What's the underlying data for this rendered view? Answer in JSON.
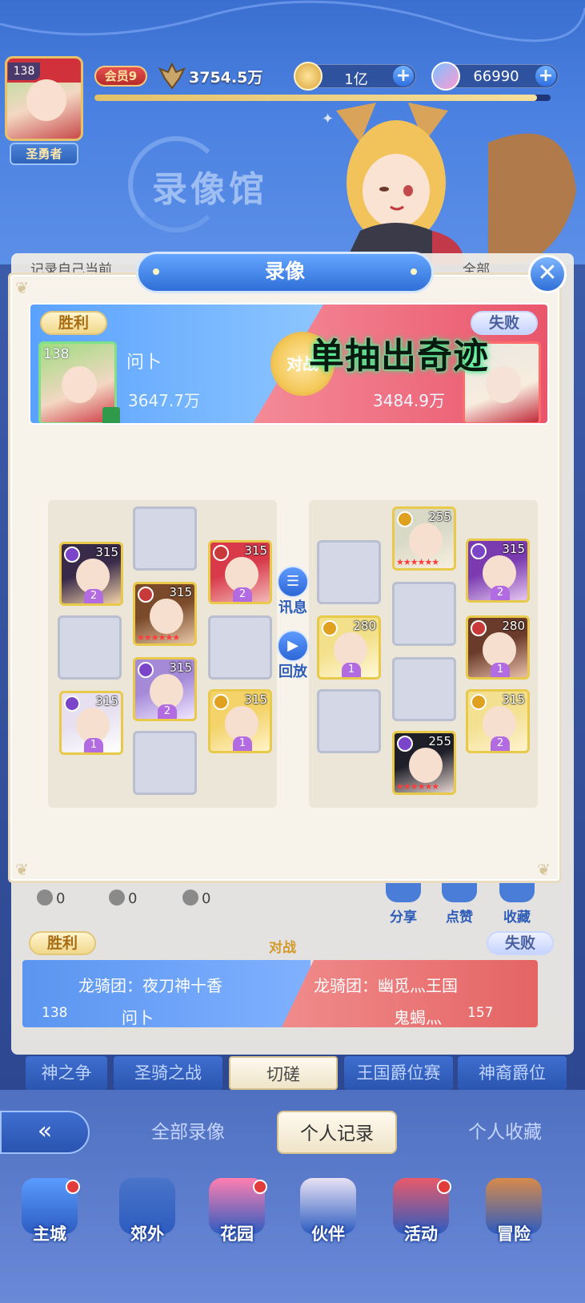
{
  "header": {
    "player_level": "138",
    "player_title": "圣勇者",
    "vip": "会员9",
    "power": "3754.5万",
    "power_bar_pct": 0.97,
    "gold": "1亿",
    "gems": "66990",
    "hall_title": "录像馆"
  },
  "list": {
    "hint": "记录自己当前",
    "all": "全部"
  },
  "modal": {
    "title": "录像",
    "close": "✕",
    "left": {
      "result": "胜利",
      "level": "138",
      "name": "问卜",
      "power": "3647.7万"
    },
    "right": {
      "result": "失败",
      "power": "3484.9万"
    },
    "vs_label": "对战",
    "overlay_caption": "单抽出奇迹",
    "mid_buttons": [
      {
        "label": "讯息",
        "icon": "message-icon"
      },
      {
        "label": "回放",
        "icon": "replay-icon"
      }
    ],
    "left_team": [
      {
        "slot": "empty"
      },
      {
        "slot": "hero",
        "level": "315",
        "star": "2",
        "colors": [
          "#3a2a4a",
          "#f2d2a8"
        ],
        "type_color": "#7a45c8"
      },
      {
        "slot": "hero",
        "level": "315",
        "star": "2",
        "colors": [
          "#d83a4a",
          "#f3b8b8"
        ],
        "type_color": "#c83a3a"
      },
      {
        "slot": "hero",
        "level": "315",
        "star": "",
        "colors": [
          "#7a4a2a",
          "#e8c8a8"
        ],
        "type_color": "#c83a3a"
      },
      {
        "slot": "empty"
      },
      {
        "slot": "empty"
      },
      {
        "slot": "hero",
        "level": "315",
        "star": "2",
        "colors": [
          "#a58ad8",
          "#efe6ff"
        ],
        "type_color": "#7a45c8"
      },
      {
        "slot": "hero",
        "level": "315",
        "star": "1",
        "colors": [
          "#e6e0f0",
          "#ffffff"
        ],
        "type_color": "#7a45c8"
      },
      {
        "slot": "hero",
        "level": "315",
        "star": "1",
        "colors": [
          "#f3d36a",
          "#fff2c8"
        ],
        "type_color": "#e0a020"
      },
      {
        "slot": "empty"
      }
    ],
    "right_team": [
      {
        "slot": "hero",
        "level": "255",
        "star": "",
        "colors": [
          "#d9d9c8",
          "#f7efe0"
        ],
        "type_color": "#e0a020"
      },
      {
        "slot": "empty"
      },
      {
        "slot": "hero",
        "level": "315",
        "star": "2",
        "colors": [
          "#7a3ab0",
          "#e5c8f0"
        ],
        "type_color": "#7a45c8"
      },
      {
        "slot": "empty"
      },
      {
        "slot": "hero",
        "level": "280",
        "star": "1",
        "colors": [
          "#f3e08a",
          "#fff8d8"
        ],
        "type_color": "#e0a020"
      },
      {
        "slot": "hero",
        "level": "280",
        "star": "1",
        "colors": [
          "#6a3a2a",
          "#e8c0a8"
        ],
        "type_color": "#c83a3a"
      },
      {
        "slot": "empty"
      },
      {
        "slot": "empty"
      },
      {
        "slot": "hero",
        "level": "315",
        "star": "2",
        "colors": [
          "#f3e090",
          "#fff3d0"
        ],
        "type_color": "#e0a020"
      },
      {
        "slot": "hero",
        "level": "255",
        "star": "",
        "colors": [
          "#1f1f2a",
          "#e6d6d0"
        ],
        "type_color": "#7a45c8"
      }
    ]
  },
  "record_stats": {
    "plays": "0",
    "shares": "0",
    "likes": "0"
  },
  "record_actions": [
    {
      "label": "分享",
      "icon": "share-icon"
    },
    {
      "label": "点赞",
      "icon": "like-icon"
    },
    {
      "label": "收藏",
      "icon": "favorite-icon"
    }
  ],
  "record2": {
    "left_result": "胜利",
    "vs_label": "对战",
    "right_result": "失败",
    "left_team": "龙骑团：夜刀神十香",
    "right_team": "龙骑团：幽觅灬王国",
    "left_level": "138",
    "left_name": "问卜",
    "right_name": "鬼蝎灬",
    "right_level": "157"
  },
  "mode_tabs": [
    "神之争",
    "圣骑之战",
    "切磋",
    "王国爵位赛",
    "神裔爵位"
  ],
  "mode_active": 2,
  "record_tabs": [
    "全部录像",
    "个人记录",
    "个人收藏"
  ],
  "record_active": 1,
  "nav": [
    {
      "label": "主城",
      "icon": "castle-icon",
      "dot": true,
      "color": "#5a9bff"
    },
    {
      "label": "郊外",
      "icon": "outskirts-icon",
      "dot": false,
      "color": "#4a74c8"
    },
    {
      "label": "花园",
      "icon": "garden-icon",
      "dot": true,
      "color": "#ff7fb0"
    },
    {
      "label": "伙伴",
      "icon": "partner-icon",
      "dot": false,
      "color": "#e8e2f4"
    },
    {
      "label": "活动",
      "icon": "event-gift-icon",
      "dot": true,
      "color": "#e85a6a"
    },
    {
      "label": "冒险",
      "icon": "adventure-icon",
      "dot": false,
      "color": "#d88a4a"
    }
  ]
}
